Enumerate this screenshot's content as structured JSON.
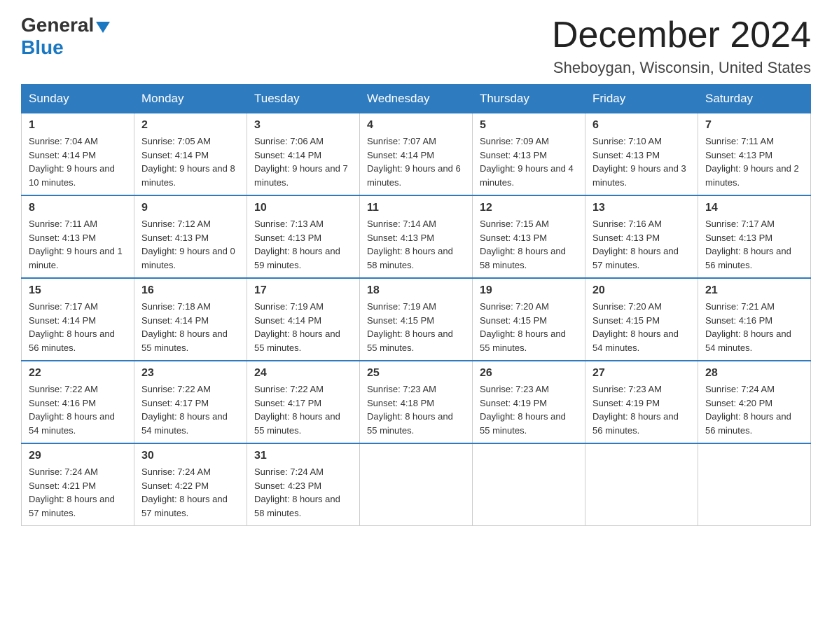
{
  "logo": {
    "general": "General",
    "blue": "Blue"
  },
  "title": "December 2024",
  "subtitle": "Sheboygan, Wisconsin, United States",
  "headers": [
    "Sunday",
    "Monday",
    "Tuesday",
    "Wednesday",
    "Thursday",
    "Friday",
    "Saturday"
  ],
  "weeks": [
    [
      {
        "day": "1",
        "sunrise": "7:04 AM",
        "sunset": "4:14 PM",
        "daylight": "9 hours and 10 minutes."
      },
      {
        "day": "2",
        "sunrise": "7:05 AM",
        "sunset": "4:14 PM",
        "daylight": "9 hours and 8 minutes."
      },
      {
        "day": "3",
        "sunrise": "7:06 AM",
        "sunset": "4:14 PM",
        "daylight": "9 hours and 7 minutes."
      },
      {
        "day": "4",
        "sunrise": "7:07 AM",
        "sunset": "4:14 PM",
        "daylight": "9 hours and 6 minutes."
      },
      {
        "day": "5",
        "sunrise": "7:09 AM",
        "sunset": "4:13 PM",
        "daylight": "9 hours and 4 minutes."
      },
      {
        "day": "6",
        "sunrise": "7:10 AM",
        "sunset": "4:13 PM",
        "daylight": "9 hours and 3 minutes."
      },
      {
        "day": "7",
        "sunrise": "7:11 AM",
        "sunset": "4:13 PM",
        "daylight": "9 hours and 2 minutes."
      }
    ],
    [
      {
        "day": "8",
        "sunrise": "7:11 AM",
        "sunset": "4:13 PM",
        "daylight": "9 hours and 1 minute."
      },
      {
        "day": "9",
        "sunrise": "7:12 AM",
        "sunset": "4:13 PM",
        "daylight": "9 hours and 0 minutes."
      },
      {
        "day": "10",
        "sunrise": "7:13 AM",
        "sunset": "4:13 PM",
        "daylight": "8 hours and 59 minutes."
      },
      {
        "day": "11",
        "sunrise": "7:14 AM",
        "sunset": "4:13 PM",
        "daylight": "8 hours and 58 minutes."
      },
      {
        "day": "12",
        "sunrise": "7:15 AM",
        "sunset": "4:13 PM",
        "daylight": "8 hours and 58 minutes."
      },
      {
        "day": "13",
        "sunrise": "7:16 AM",
        "sunset": "4:13 PM",
        "daylight": "8 hours and 57 minutes."
      },
      {
        "day": "14",
        "sunrise": "7:17 AM",
        "sunset": "4:13 PM",
        "daylight": "8 hours and 56 minutes."
      }
    ],
    [
      {
        "day": "15",
        "sunrise": "7:17 AM",
        "sunset": "4:14 PM",
        "daylight": "8 hours and 56 minutes."
      },
      {
        "day": "16",
        "sunrise": "7:18 AM",
        "sunset": "4:14 PM",
        "daylight": "8 hours and 55 minutes."
      },
      {
        "day": "17",
        "sunrise": "7:19 AM",
        "sunset": "4:14 PM",
        "daylight": "8 hours and 55 minutes."
      },
      {
        "day": "18",
        "sunrise": "7:19 AM",
        "sunset": "4:15 PM",
        "daylight": "8 hours and 55 minutes."
      },
      {
        "day": "19",
        "sunrise": "7:20 AM",
        "sunset": "4:15 PM",
        "daylight": "8 hours and 55 minutes."
      },
      {
        "day": "20",
        "sunrise": "7:20 AM",
        "sunset": "4:15 PM",
        "daylight": "8 hours and 54 minutes."
      },
      {
        "day": "21",
        "sunrise": "7:21 AM",
        "sunset": "4:16 PM",
        "daylight": "8 hours and 54 minutes."
      }
    ],
    [
      {
        "day": "22",
        "sunrise": "7:22 AM",
        "sunset": "4:16 PM",
        "daylight": "8 hours and 54 minutes."
      },
      {
        "day": "23",
        "sunrise": "7:22 AM",
        "sunset": "4:17 PM",
        "daylight": "8 hours and 54 minutes."
      },
      {
        "day": "24",
        "sunrise": "7:22 AM",
        "sunset": "4:17 PM",
        "daylight": "8 hours and 55 minutes."
      },
      {
        "day": "25",
        "sunrise": "7:23 AM",
        "sunset": "4:18 PM",
        "daylight": "8 hours and 55 minutes."
      },
      {
        "day": "26",
        "sunrise": "7:23 AM",
        "sunset": "4:19 PM",
        "daylight": "8 hours and 55 minutes."
      },
      {
        "day": "27",
        "sunrise": "7:23 AM",
        "sunset": "4:19 PM",
        "daylight": "8 hours and 56 minutes."
      },
      {
        "day": "28",
        "sunrise": "7:24 AM",
        "sunset": "4:20 PM",
        "daylight": "8 hours and 56 minutes."
      }
    ],
    [
      {
        "day": "29",
        "sunrise": "7:24 AM",
        "sunset": "4:21 PM",
        "daylight": "8 hours and 57 minutes."
      },
      {
        "day": "30",
        "sunrise": "7:24 AM",
        "sunset": "4:22 PM",
        "daylight": "8 hours and 57 minutes."
      },
      {
        "day": "31",
        "sunrise": "7:24 AM",
        "sunset": "4:23 PM",
        "daylight": "8 hours and 58 minutes."
      },
      null,
      null,
      null,
      null
    ]
  ],
  "labels": {
    "sunrise": "Sunrise: ",
    "sunset": "Sunset: ",
    "daylight": "Daylight: "
  }
}
